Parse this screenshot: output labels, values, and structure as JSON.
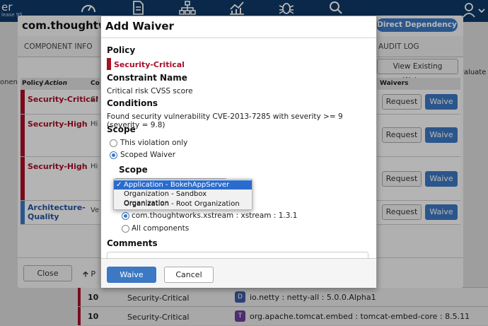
{
  "nav": {
    "brand": "er",
    "release": "lease 95",
    "icons": [
      "dashboard-icon",
      "document-icon",
      "hierarchy-icon",
      "chart-icon",
      "bug-icon",
      "search-icon",
      "user-icon"
    ]
  },
  "background": {
    "left_cut_text": "onen",
    "evaluate_cut_text": "valuate",
    "rows": [
      {
        "count": "10",
        "severity": "Security-Critical",
        "badge": "D",
        "badge_color": "#3c5aa6",
        "coordinate": "io.netty : netty-all : 5.0.0.Alpha1"
      },
      {
        "count": "10",
        "severity": "Security-Critical",
        "badge": "T",
        "badge_color": "#6b3f99",
        "coordinate": "org.apache.tomcat.embed : tomcat-embed-core : 8.5.11"
      }
    ]
  },
  "component_dialog": {
    "title": "com.thoughtwo",
    "badge": "Direct Dependency",
    "tabs": [
      "COMPONENT INFO",
      "AUDIT LOG"
    ],
    "view_waivers_label": "View Existing Waivers",
    "table": {
      "policy_header": "Policy",
      "action_header": "Action",
      "waivers_header": "Waivers",
      "cut_header": "Co"
    },
    "rows": [
      {
        "label": "Security-Critical",
        "label2": "",
        "cut": "Cr",
        "color": "#a80f28",
        "text_color": "#a80f28"
      },
      {
        "label": "Security-High",
        "label2": "",
        "cut": "Hi",
        "color": "#a80f28",
        "text_color": "#a80f28"
      },
      {
        "label": "Security-High",
        "label2": "",
        "cut": "Hi",
        "color": "#a80f28",
        "text_color": "#a80f28"
      },
      {
        "label": "Architecture-",
        "label2": "Quality",
        "cut": "Ve",
        "color": "#3c78c3",
        "text_color": "#2255a0"
      }
    ],
    "request_label": "Request",
    "waive_label": "Waive",
    "close_label": "Close",
    "prev_label": "P"
  },
  "waiver": {
    "title": "Add Waiver",
    "policy_heading": "Policy",
    "policy_value": "Security-Critical",
    "constraint_heading": "Constraint Name",
    "constraint_value": "Critical risk CVSS score",
    "conditions_heading": "Conditions",
    "conditions_value": "Found security vulnerability CVE-2013-7285 with severity >= 9 (severity = 9.8)",
    "scope_heading": "Scope",
    "scope_options": [
      "This violation only",
      "Scoped Waiver"
    ],
    "scope_sub_heading": "Scope",
    "dropdown_options": [
      {
        "label": "Application - BokehAppServer",
        "selected": true
      },
      {
        "label": "Organization - Sandbox Organization",
        "selected": false
      },
      {
        "label": "Organization - Root Organization",
        "selected": false
      }
    ],
    "component_options": [
      "com.thoughtworks.xstream : xstream : 1.3.1",
      "All components"
    ],
    "comments_heading": "Comments",
    "waive_label": "Waive",
    "cancel_label": "Cancel"
  }
}
